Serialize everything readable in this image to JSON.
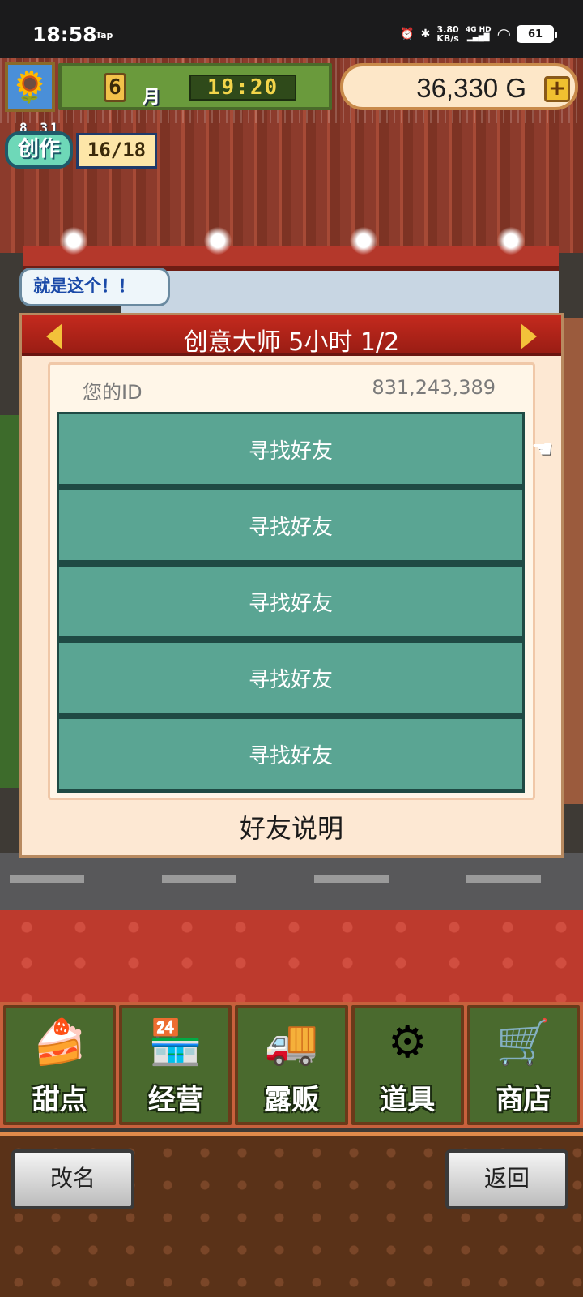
{
  "status_bar": {
    "time": "18:58",
    "app_tag": "Tap",
    "speed_value": "3.80",
    "speed_unit": "KB/s",
    "net_top": "4G HD",
    "battery": "61"
  },
  "hud": {
    "month_number": "6",
    "month_label": "月",
    "clock": "19:20",
    "gold": "36,330 G",
    "plus_label": "+",
    "create_date": "8 31",
    "create_label": "创作",
    "create_count": "16/18"
  },
  "speech_bubble": "就是这个！！",
  "dialog": {
    "title": "创意大师  5小时 1/2",
    "id_label": "您的ID",
    "id_value": "831,243,389",
    "friend_buttons": [
      "寻找好友",
      "寻找好友",
      "寻找好友",
      "寻找好友",
      "寻找好友"
    ],
    "footer": "好友说明"
  },
  "menu": [
    {
      "label": "甜点",
      "icon": "cake-icon"
    },
    {
      "label": "经营",
      "icon": "shop-icon"
    },
    {
      "label": "露贩",
      "icon": "food-truck-icon"
    },
    {
      "label": "道具",
      "icon": "tools-icon"
    },
    {
      "label": "商店",
      "icon": "cart-icon"
    }
  ],
  "bottom": {
    "rename_label": "改名",
    "back_label": "返回"
  },
  "colors": {
    "friend_button": "#5aa593",
    "dialog_header": "#c42a1e",
    "menu_bg": "#4a6a2e"
  }
}
